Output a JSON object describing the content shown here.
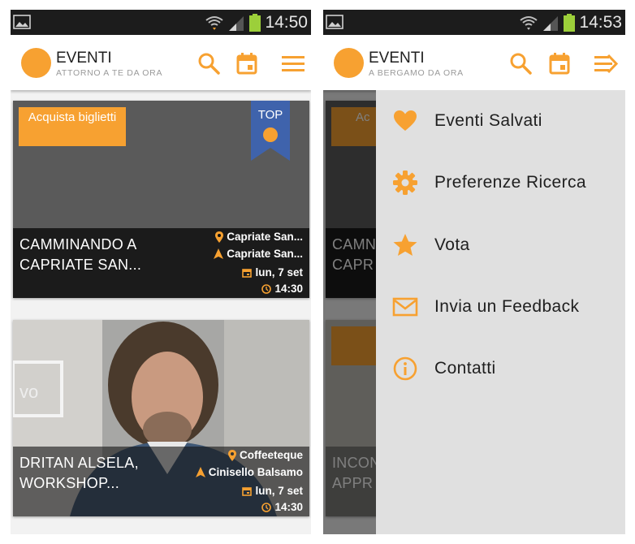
{
  "colors": {
    "accent": "#f7a131",
    "status_bar": "#1c1c1c",
    "badge_blue": "#3f63ac",
    "drawer_bg": "#e0e0e0"
  },
  "left": {
    "status": {
      "time": "14:50"
    },
    "app": {
      "title": "EVENTI",
      "subtitle": "ATTORNO A TE DA ORA"
    },
    "cards": [
      {
        "ticket_label": "Acquista biglietti",
        "badge": "TOP",
        "title": "CAMMINANDO A CAPRIATE SAN...",
        "venue": "Capriate San...",
        "city": "Capriate San...",
        "date": "lun, 7 set",
        "time": "14:30"
      },
      {
        "title": "DRITAN ALSELA, WORKSHOP...",
        "venue": "Coffeeteque",
        "city": "Cinisello Balsamo",
        "date": "lun, 7 set",
        "time": "14:30"
      }
    ]
  },
  "right": {
    "status": {
      "time": "14:53"
    },
    "app": {
      "title": "EVENTI",
      "subtitle": "A BERGAMO DA ORA"
    },
    "background_fragments": {
      "ticket_fragment": "Ac",
      "card1_fragment": "CAMN",
      "card1_fragment2": "CAPR",
      "card2_fragment": "INCON",
      "card2_fragment2": "APPR"
    },
    "drawer": {
      "items": [
        {
          "label": "Eventi Salvati",
          "icon": "heart-icon"
        },
        {
          "label": "Preferenze Ricerca",
          "icon": "gear-icon"
        },
        {
          "label": "Vota",
          "icon": "star-icon"
        },
        {
          "label": "Invia un Feedback",
          "icon": "mail-icon"
        },
        {
          "label": "Contatti",
          "icon": "info-icon"
        }
      ]
    }
  }
}
